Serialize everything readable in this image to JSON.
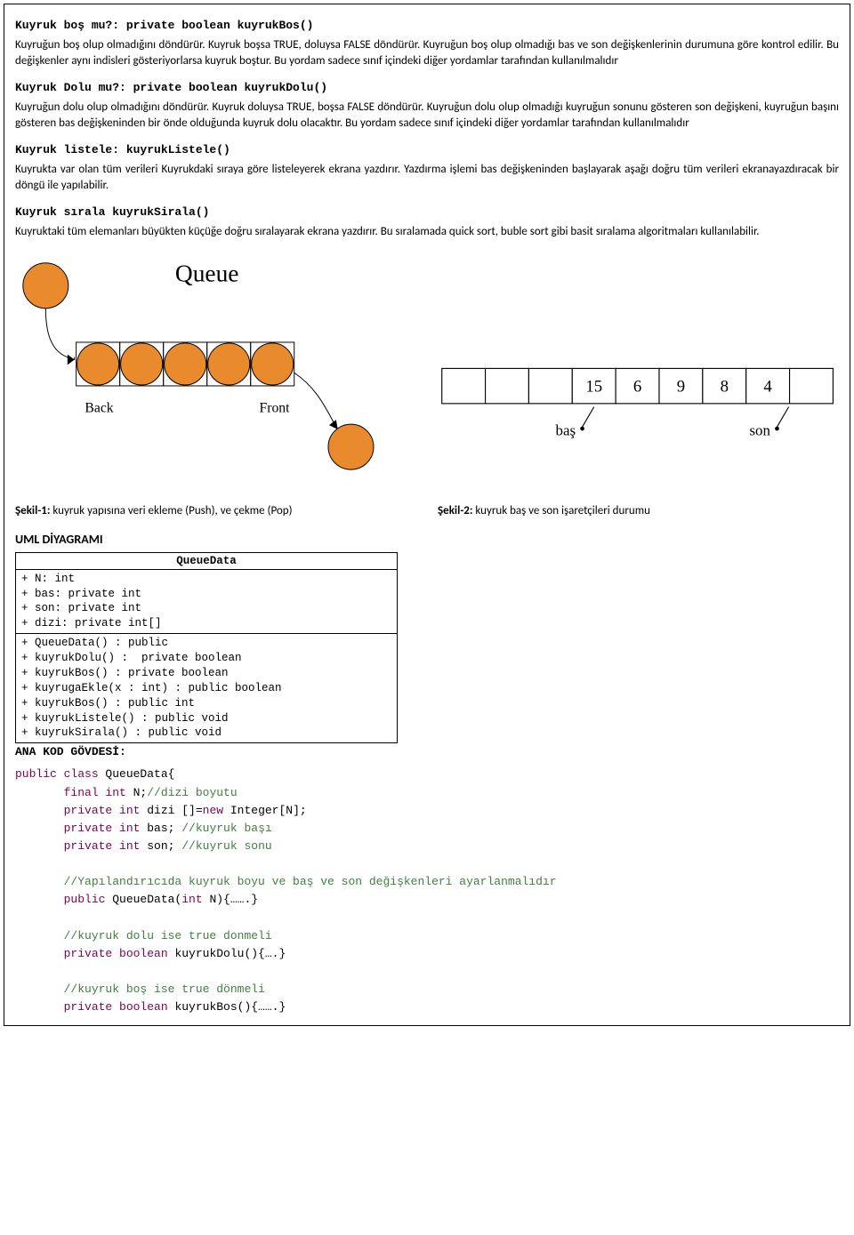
{
  "sections": {
    "kuyrukBos": {
      "heading": "Kuyruk boş mu?: private boolean kuyrukBos()",
      "body": "Kuyruğun boş olup olmadığını döndürür. Kuyruk boşsa TRUE, doluysa FALSE döndürür. Kuyruğun boş olup olmadığı bas ve son değişkenlerinin durumuna göre kontrol edilir. Bu değişkenler aynı indisleri gösteriyorlarsa kuyruk boştur. Bu yordam sadece sınıf içindeki diğer yordamlar tarafından kullanılmalıdır"
    },
    "kuyrukDolu": {
      "heading": "Kuyruk Dolu mu?: private boolean kuyrukDolu()",
      "body": "Kuyruğun dolu olup olmadığını döndürür. Kuyruk doluysa TRUE, boşsa FALSE döndürür. Kuyruğun dolu olup olmadığı kuyruğun sonunu gösteren son değişkeni, kuyruğun başını gösteren bas değişkeninden bir önde olduğunda kuyruk dolu olacaktır. Bu yordam sadece sınıf içindeki diğer yordamlar tarafından kullanılmalıdır"
    },
    "kuyrukListele": {
      "heading": "Kuyruk listele: kuyrukListele()",
      "body": "Kuyrukta var olan tüm verileri Kuyrukdaki sıraya göre listeleyerek ekrana yazdırır. Yazdırma işlemi bas değişkeninden başlayarak aşağı doğru tüm verileri ekranayazdıracak bir döngü ile yapılabilir."
    },
    "kuyrukSirala": {
      "heading": "Kuyruk sırala kuyrukSirala()",
      "body": "Kuyruktaki tüm elemanları büyükten küçüğe doğru sıralayarak ekrana yazdırır. Bu sıralamada quick sort, buble sort gibi basit sıralama algoritmaları kullanılabilir."
    }
  },
  "figure1": {
    "title": "Queue",
    "labels": {
      "back": "Back",
      "front": "Front"
    },
    "caption_bold": "Şekil-1:",
    "caption_rest": " kuyruk yapısına veri ekleme (Push), ve çekme (Pop)"
  },
  "figure2": {
    "values": [
      "15",
      "6",
      "9",
      "8",
      "4"
    ],
    "labels": {
      "bas": "baş",
      "son": "son"
    },
    "caption_bold": "Şekil-2:",
    "caption_rest": " kuyruk baş ve son işaretçileri durumu"
  },
  "umlHeading": "UML DİYAGRAMI",
  "uml": {
    "className": "QueueData",
    "attrs": [
      "+ N: int",
      "+ bas: private int",
      "+ son: private int",
      "+ dizi: private int[]"
    ],
    "ops": [
      "+ QueueData() : public",
      "+ kuyrukDolu() :  private boolean",
      "+ kuyrukBos() : private boolean",
      "+ kuyrugaEkle(x : int) : public boolean",
      "+ kuyrukBos() : public int",
      "+ kuyrukListele() : public void",
      "+ kuyrukSirala() : public void"
    ]
  },
  "codeHeading": "ANA KOD GÖVDESİ:",
  "code": {
    "l1a": "public class",
    "l1b": " QueueData{",
    "l2a": "       final int",
    "l2b": " N;",
    "l2c": "//dizi boyutu",
    "l3a": "       private int",
    "l3b": " dizi []=",
    "l3c": "new",
    "l3d": " Integer[N];",
    "l4a": "       private int",
    "l4b": " bas; ",
    "l4c": "//kuyruk başı",
    "l5a": "       private int",
    "l5b": " son; ",
    "l5c": "//kuyruk sonu",
    "l6": "       //Yapılandırıcıda kuyruk boyu ve baş ve son değişkenleri ayarlanmalıdır",
    "l7a": "       public",
    "l7b": " QueueData(",
    "l7c": "int",
    "l7d": " N){…….}",
    "l8": "       //kuyruk dolu ise true donmeli",
    "l9a": "       private boolean",
    "l9b": " kuyrukDolu(){….}",
    "l10": "       //kuyruk boş ise true dönmeli",
    "l11a": "       private boolean",
    "l11b": " kuyrukBos(){…….}"
  },
  "chart_data": {
    "type": "table",
    "figure1": {
      "description": "Queue push/pop diagram",
      "slots_filled_from_back": 5,
      "labels_left_to_right": [
        "Back",
        "Front"
      ]
    },
    "figure2": {
      "description": "queue array with head/tail pointers",
      "cells": [
        null,
        null,
        null,
        15,
        6,
        9,
        8,
        4,
        null
      ],
      "bas_pointer_index": 3,
      "son_pointer_index": 7
    }
  }
}
